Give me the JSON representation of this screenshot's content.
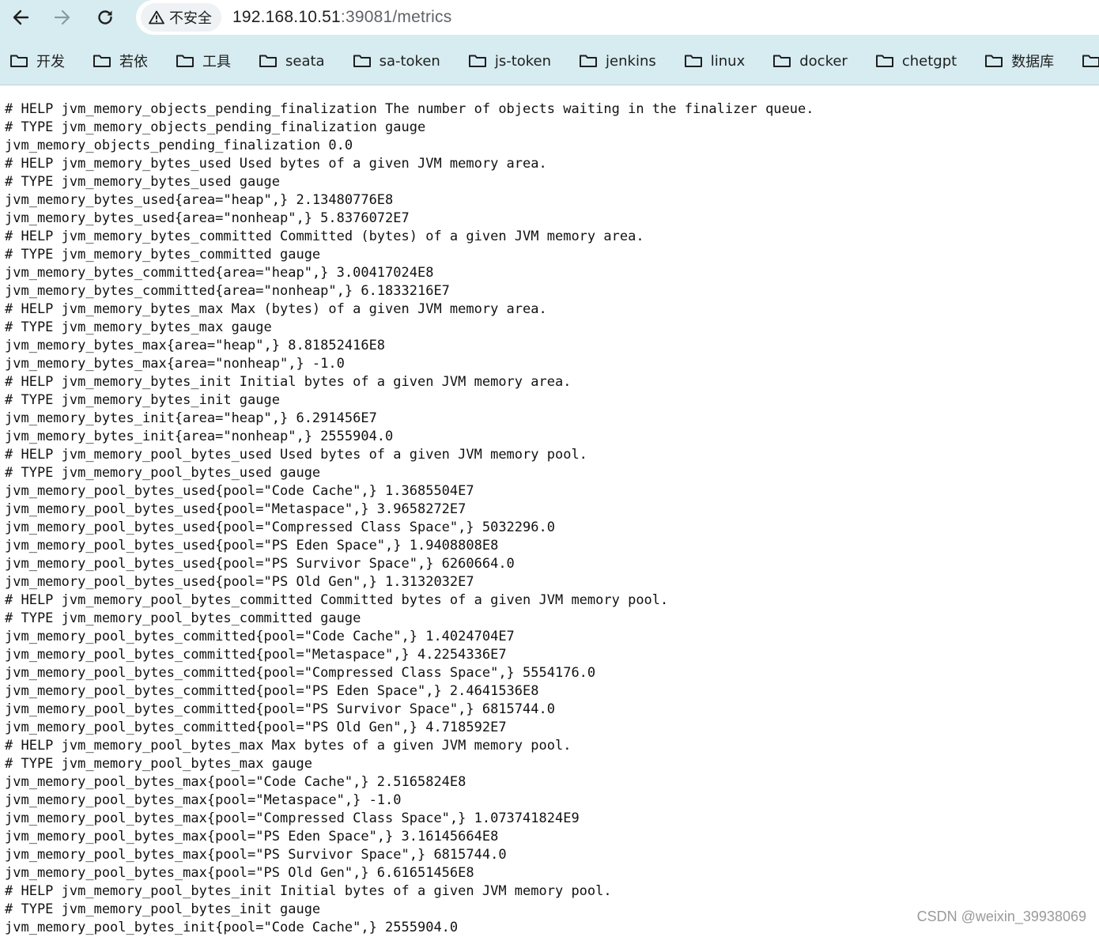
{
  "browser": {
    "security_label": "不安全",
    "url_host": "192.168.10.51",
    "url_path": ":39081/metrics",
    "bookmarks": [
      "开发",
      "若依",
      "工具",
      "seata",
      "sa-token",
      "js-token",
      "jenkins",
      "linux",
      "docker",
      "chetgpt",
      "数据库",
      ""
    ]
  },
  "lines": [
    "# HELP jvm_memory_objects_pending_finalization The number of objects waiting in the finalizer queue.",
    "# TYPE jvm_memory_objects_pending_finalization gauge",
    "jvm_memory_objects_pending_finalization 0.0",
    "# HELP jvm_memory_bytes_used Used bytes of a given JVM memory area.",
    "# TYPE jvm_memory_bytes_used gauge",
    "jvm_memory_bytes_used{area=\"heap\",} 2.13480776E8",
    "jvm_memory_bytes_used{area=\"nonheap\",} 5.8376072E7",
    "# HELP jvm_memory_bytes_committed Committed (bytes) of a given JVM memory area.",
    "# TYPE jvm_memory_bytes_committed gauge",
    "jvm_memory_bytes_committed{area=\"heap\",} 3.00417024E8",
    "jvm_memory_bytes_committed{area=\"nonheap\",} 6.1833216E7",
    "# HELP jvm_memory_bytes_max Max (bytes) of a given JVM memory area.",
    "# TYPE jvm_memory_bytes_max gauge",
    "jvm_memory_bytes_max{area=\"heap\",} 8.81852416E8",
    "jvm_memory_bytes_max{area=\"nonheap\",} -1.0",
    "# HELP jvm_memory_bytes_init Initial bytes of a given JVM memory area.",
    "# TYPE jvm_memory_bytes_init gauge",
    "jvm_memory_bytes_init{area=\"heap\",} 6.291456E7",
    "jvm_memory_bytes_init{area=\"nonheap\",} 2555904.0",
    "# HELP jvm_memory_pool_bytes_used Used bytes of a given JVM memory pool.",
    "# TYPE jvm_memory_pool_bytes_used gauge",
    "jvm_memory_pool_bytes_used{pool=\"Code Cache\",} 1.3685504E7",
    "jvm_memory_pool_bytes_used{pool=\"Metaspace\",} 3.9658272E7",
    "jvm_memory_pool_bytes_used{pool=\"Compressed Class Space\",} 5032296.0",
    "jvm_memory_pool_bytes_used{pool=\"PS Eden Space\",} 1.9408808E8",
    "jvm_memory_pool_bytes_used{pool=\"PS Survivor Space\",} 6260664.0",
    "jvm_memory_pool_bytes_used{pool=\"PS Old Gen\",} 1.3132032E7",
    "# HELP jvm_memory_pool_bytes_committed Committed bytes of a given JVM memory pool.",
    "# TYPE jvm_memory_pool_bytes_committed gauge",
    "jvm_memory_pool_bytes_committed{pool=\"Code Cache\",} 1.4024704E7",
    "jvm_memory_pool_bytes_committed{pool=\"Metaspace\",} 4.2254336E7",
    "jvm_memory_pool_bytes_committed{pool=\"Compressed Class Space\",} 5554176.0",
    "jvm_memory_pool_bytes_committed{pool=\"PS Eden Space\",} 2.4641536E8",
    "jvm_memory_pool_bytes_committed{pool=\"PS Survivor Space\",} 6815744.0",
    "jvm_memory_pool_bytes_committed{pool=\"PS Old Gen\",} 4.718592E7",
    "# HELP jvm_memory_pool_bytes_max Max bytes of a given JVM memory pool.",
    "# TYPE jvm_memory_pool_bytes_max gauge",
    "jvm_memory_pool_bytes_max{pool=\"Code Cache\",} 2.5165824E8",
    "jvm_memory_pool_bytes_max{pool=\"Metaspace\",} -1.0",
    "jvm_memory_pool_bytes_max{pool=\"Compressed Class Space\",} 1.073741824E9",
    "jvm_memory_pool_bytes_max{pool=\"PS Eden Space\",} 3.16145664E8",
    "jvm_memory_pool_bytes_max{pool=\"PS Survivor Space\",} 6815744.0",
    "jvm_memory_pool_bytes_max{pool=\"PS Old Gen\",} 6.61651456E8",
    "# HELP jvm_memory_pool_bytes_init Initial bytes of a given JVM memory pool.",
    "# TYPE jvm_memory_pool_bytes_init gauge",
    "jvm_memory_pool_bytes_init{pool=\"Code Cache\",} 2555904.0"
  ],
  "watermark": "CSDN @weixin_39938069"
}
